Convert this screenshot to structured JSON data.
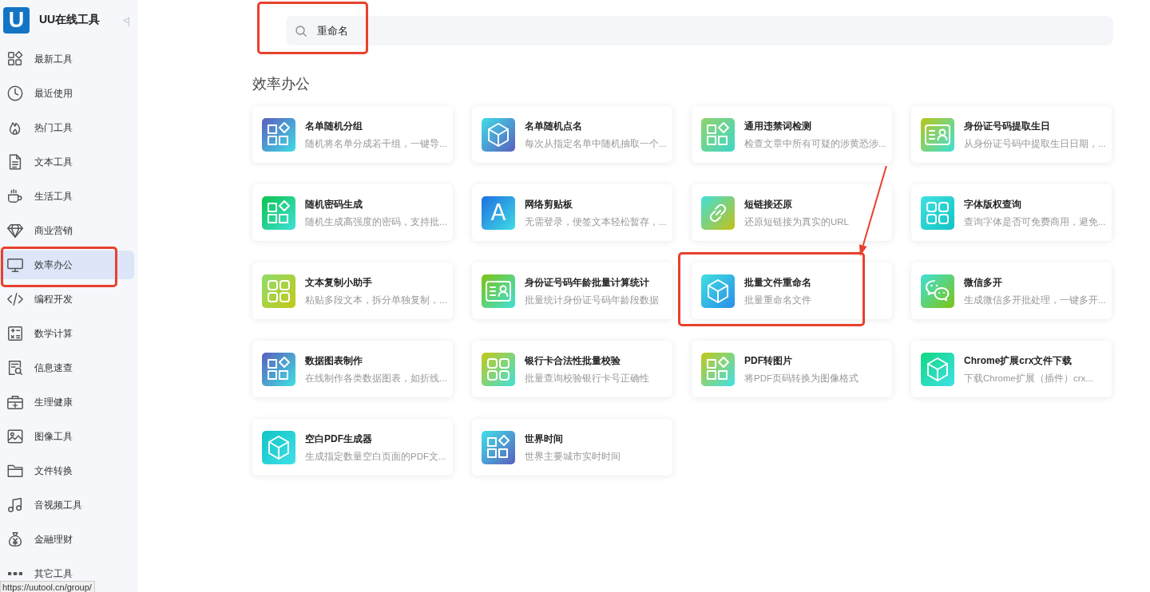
{
  "sidebar": {
    "logo_letter": "U",
    "title": "UU在线工具",
    "collapse_glyph": "<|",
    "items": [
      {
        "label": "最新工具",
        "selected": false,
        "highlighted": false
      },
      {
        "label": "最近使用",
        "selected": false,
        "highlighted": false
      },
      {
        "label": "热门工具",
        "selected": false,
        "highlighted": false
      },
      {
        "label": "文本工具",
        "selected": false,
        "highlighted": false
      },
      {
        "label": "生活工具",
        "selected": false,
        "highlighted": false
      },
      {
        "label": "商业营销",
        "selected": false,
        "highlighted": false
      },
      {
        "label": "效率办公",
        "selected": true,
        "highlighted": true
      },
      {
        "label": "编程开发",
        "selected": false,
        "highlighted": false
      },
      {
        "label": "数学计算",
        "selected": false,
        "highlighted": false
      },
      {
        "label": "信息速查",
        "selected": false,
        "highlighted": false
      },
      {
        "label": "生理健康",
        "selected": false,
        "highlighted": false
      },
      {
        "label": "图像工具",
        "selected": false,
        "highlighted": false
      },
      {
        "label": "文件转换",
        "selected": false,
        "highlighted": false
      },
      {
        "label": "音视频工具",
        "selected": false,
        "highlighted": false
      },
      {
        "label": "金融理财",
        "selected": false,
        "highlighted": false
      },
      {
        "label": "其它工具",
        "selected": false,
        "highlighted": false
      }
    ]
  },
  "search": {
    "value": "重命名",
    "highlighted": true
  },
  "section_title": "效率办公",
  "cards": [
    {
      "title": "名单随机分组",
      "desc": "随机将名单分成若干组，一键导...",
      "highlighted": false
    },
    {
      "title": "名单随机点名",
      "desc": "每次从指定名单中随机抽取一个...",
      "highlighted": false
    },
    {
      "title": "通用违禁词检测",
      "desc": "检查文章中所有可疑的涉黄恐涉...",
      "highlighted": false
    },
    {
      "title": "身份证号码提取生日",
      "desc": "从身份证号码中提取生日日期，...",
      "highlighted": false
    },
    {
      "title": "随机密码生成",
      "desc": "随机生成高强度的密码，支持批...",
      "highlighted": false
    },
    {
      "title": "网络剪贴板",
      "desc": "无需登录，便签文本轻松暂存，...",
      "glyph": "A",
      "highlighted": false
    },
    {
      "title": "短链接还原",
      "desc": "还原短链接为真实的URL",
      "highlighted": false
    },
    {
      "title": "字体版权查询",
      "desc": "查询字体是否可免费商用，避免...",
      "highlighted": false
    },
    {
      "title": "文本复制小助手",
      "desc": "粘贴多段文本，拆分单独复制，...",
      "highlighted": false
    },
    {
      "title": "身份证号码年龄批量计算统计",
      "desc": "批量统计身份证号码年龄段数据",
      "highlighted": false
    },
    {
      "title": "批量文件重命名",
      "desc": "批量重命名文件",
      "highlighted": true
    },
    {
      "title": "微信多开",
      "desc": "生成微信多开批处理，一键多开...",
      "highlighted": false
    },
    {
      "title": "数据图表制作",
      "desc": "在线制作各类数据图表，如折线...",
      "highlighted": false
    },
    {
      "title": "银行卡合法性批量校验",
      "desc": "批量查询校验银行卡号正确性",
      "highlighted": false
    },
    {
      "title": "PDF转图片",
      "desc": "将PDF页码转换为图像格式",
      "highlighted": false
    },
    {
      "title": "Chrome扩展crx文件下载",
      "desc": "下载Chrome扩展（插件）crx...",
      "highlighted": false
    },
    {
      "title": "空白PDF生成器",
      "desc": "生成指定数量空白页面的PDF文...",
      "highlighted": false
    },
    {
      "title": "世界时间",
      "desc": "世界主要城市实时时间",
      "highlighted": false
    }
  ],
  "status_url": "https://uutool.cn/group/"
}
